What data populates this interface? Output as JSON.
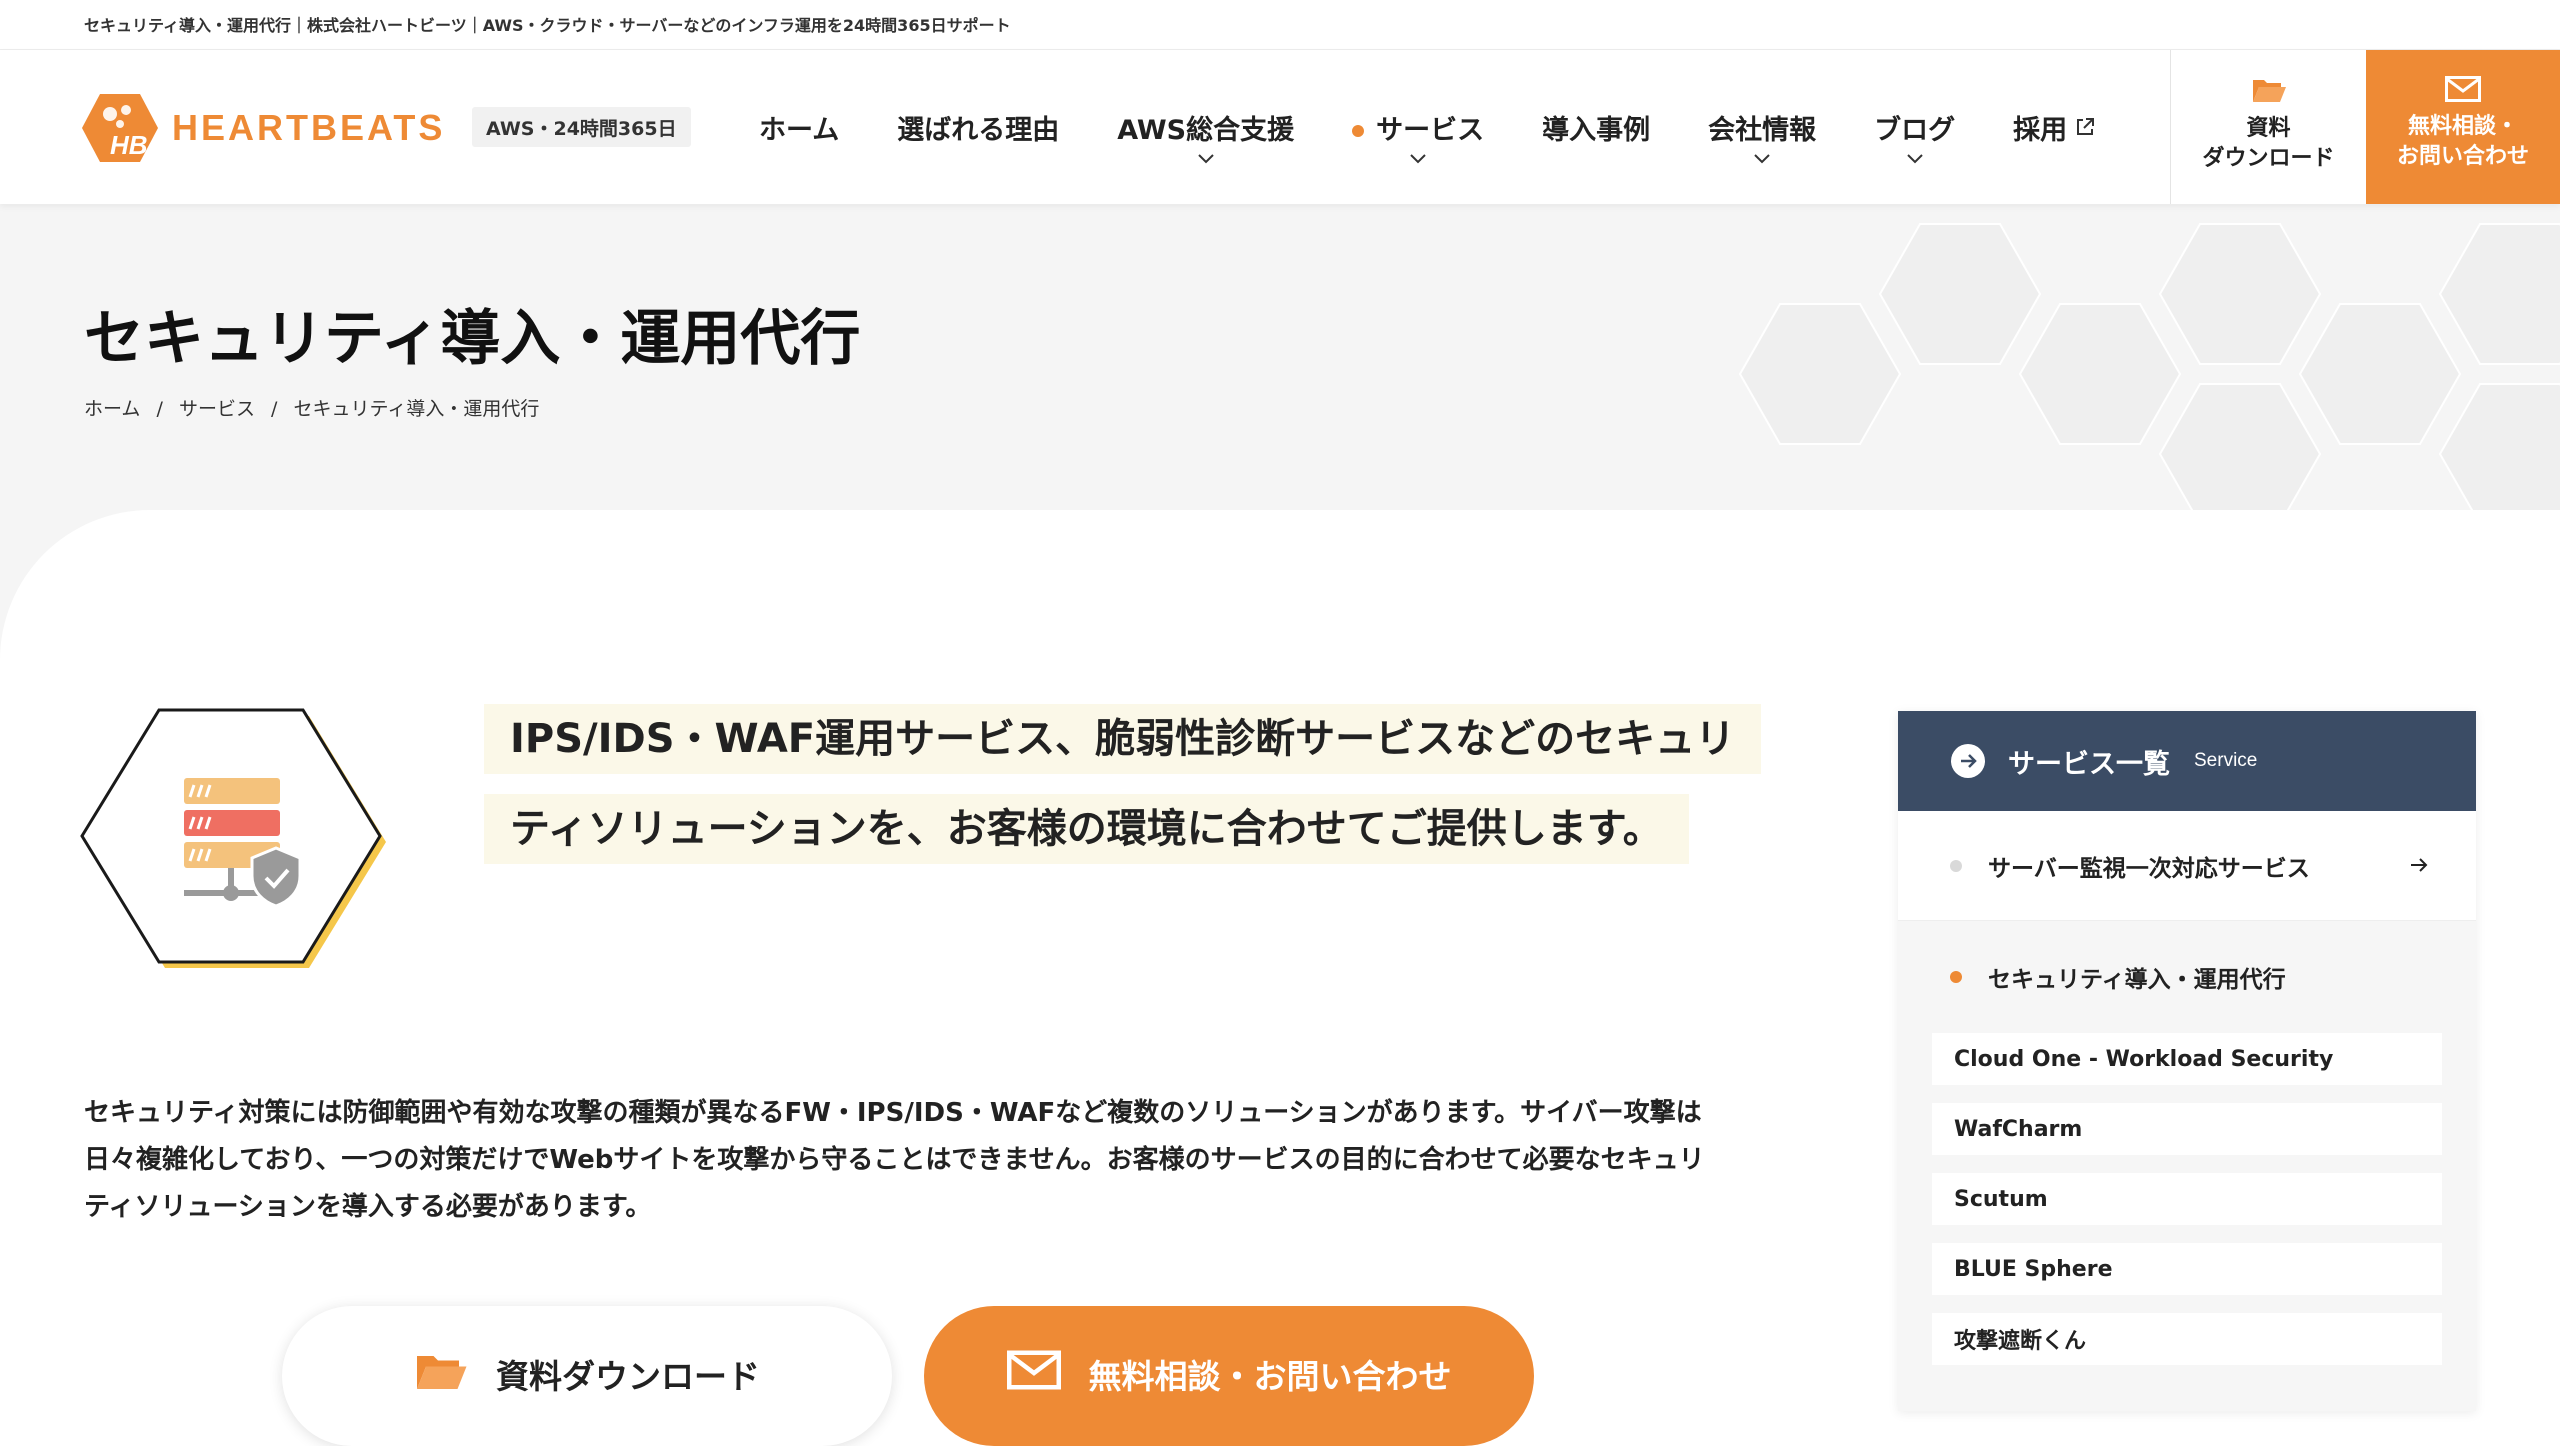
{
  "topbar": {
    "text": "セキュリティ導入・運用代行｜株式会社ハートビーツ｜AWS・クラウド・サーバーなどのインフラ運用を24時間365日サポート"
  },
  "header": {
    "logo_text": "HEARTBEATS",
    "logo_mark": "HB",
    "badge": "AWS・24時間365日",
    "nav": [
      {
        "label": "ホーム"
      },
      {
        "label": "選ばれる理由"
      },
      {
        "label": "AWS総合支援"
      },
      {
        "label": "サービス"
      },
      {
        "label": "導入事例"
      },
      {
        "label": "会社情報"
      },
      {
        "label": "ブログ"
      },
      {
        "label": "採用"
      }
    ],
    "download_line1": "資料",
    "download_line2": "ダウンロード",
    "contact_line1": "無料相談・",
    "contact_line2": "お問い合わせ"
  },
  "hero": {
    "title": "セキュリティ導入・運用代行",
    "breadcrumb": [
      "ホーム",
      "サービス",
      "セキュリティ導入・運用代行"
    ],
    "separator": "/"
  },
  "main": {
    "lead": "IPS/IDS・WAF運用サービス、脆弱性診断サービスなどのセキュリティソリューションを、お客様の環境に合わせてご提供します。",
    "body": "セキュリティ対策には防御範囲や有効な攻撃の種類が異なるFW・IPS/IDS・WAFなど複数のソリューションがあります。サイバー攻撃は日々複雑化しており、一つの対策だけでWebサイトを攻撃から守ることはできません。お客様のサービスの目的に合わせて必要なセキュリティソリューションを導入する必要があります。",
    "cta_download": "資料ダウンロード",
    "cta_contact": "無料相談・お問い合わせ"
  },
  "sidebar": {
    "title": "サービス一覧",
    "subtitle": "Service",
    "item_monitoring": "サーバー監視一次対応サービス",
    "item_security": "セキュリティ導入・運用代行",
    "sub_items": [
      "Cloud One - Workload Security",
      "WafCharm",
      "Scutum",
      "BLUE Sphere",
      "攻撃遮断くん"
    ]
  },
  "colors": {
    "accent": "#ee8a35",
    "sidebar_head": "#3b4c65",
    "lead_highlight": "#fbf8e8"
  }
}
